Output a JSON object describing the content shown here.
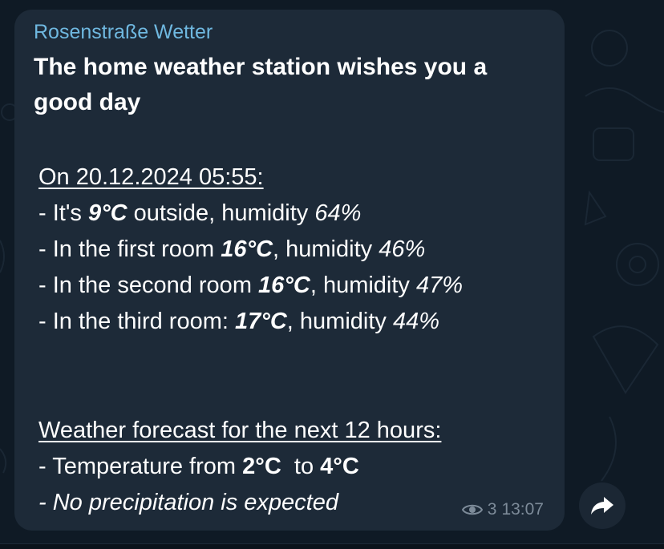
{
  "message": {
    "channel_name": "Rosenstraße Wetter",
    "headline": "The home weather station wishes you a good day",
    "report": {
      "date_line": "On 20.12.2024 05:55:",
      "outside": {
        "prefix": "- It's ",
        "temp": "9°C",
        "middle": " outside, humidity ",
        "humidity": "64%"
      },
      "room1": {
        "prefix": "- In the first room ",
        "temp": "16°C",
        "middle": ", humidity ",
        "humidity": "46%"
      },
      "room2": {
        "prefix": "- In the second room ",
        "temp": "16°C",
        "middle": ", humidity ",
        "humidity": "47%"
      },
      "room3": {
        "prefix": "- In the third room: ",
        "temp": "17°C",
        "middle": ", humidity ",
        "humidity": "44%"
      }
    },
    "forecast": {
      "heading": "Weather forecast for the next 12 hours:",
      "temperature": {
        "prefix": "- Temperature from ",
        "low": "2°C",
        "middle": "  to ",
        "high": "4°C"
      },
      "precipitation": "- No precipitation is expected"
    },
    "views": "3",
    "time": "13:07"
  },
  "icons": {
    "views": "eye-icon",
    "share": "share-arrow-icon"
  },
  "colors": {
    "background": "#0f1a25",
    "bubble": "#1d2a38",
    "channel_name": "#6fb8e0",
    "text": "#ffffff",
    "meta": "#7d8b99"
  }
}
